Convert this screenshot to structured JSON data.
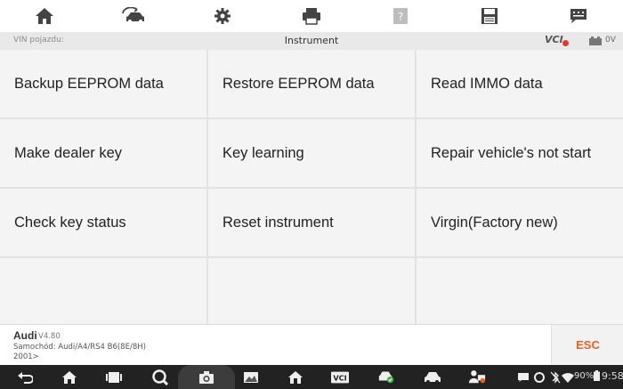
{
  "toolbar": {
    "items": [
      "home-icon",
      "vehicle-swap-icon",
      "settings-icon",
      "print-icon",
      "help-icon",
      "save-icon",
      "message-icon"
    ]
  },
  "infobar": {
    "vin_label": "VIN pojazdu:",
    "title": "Instrument",
    "vci_label": "VCI",
    "voltage": "0V"
  },
  "functions": [
    "Backup EEPROM data",
    "Restore EEPROM data",
    "Read IMMO data",
    "Make dealer key",
    "Key learning",
    "Repair vehicle's not start",
    "Check key status",
    "Reset instrument",
    "Virgin(Factory new)"
  ],
  "vehicle": {
    "make": "Audi",
    "version": "V4.80",
    "model": "Samochód: Audi/A4/RS4 B6(8E/8H)",
    "year": "2001>"
  },
  "esc_label": "ESC",
  "statusbar": {
    "battery": "90%",
    "time": "9:58"
  },
  "colors": {
    "accent": "#e8601c",
    "toolbar_icon": "#444444",
    "grid_cell": "#f4f4f4"
  }
}
